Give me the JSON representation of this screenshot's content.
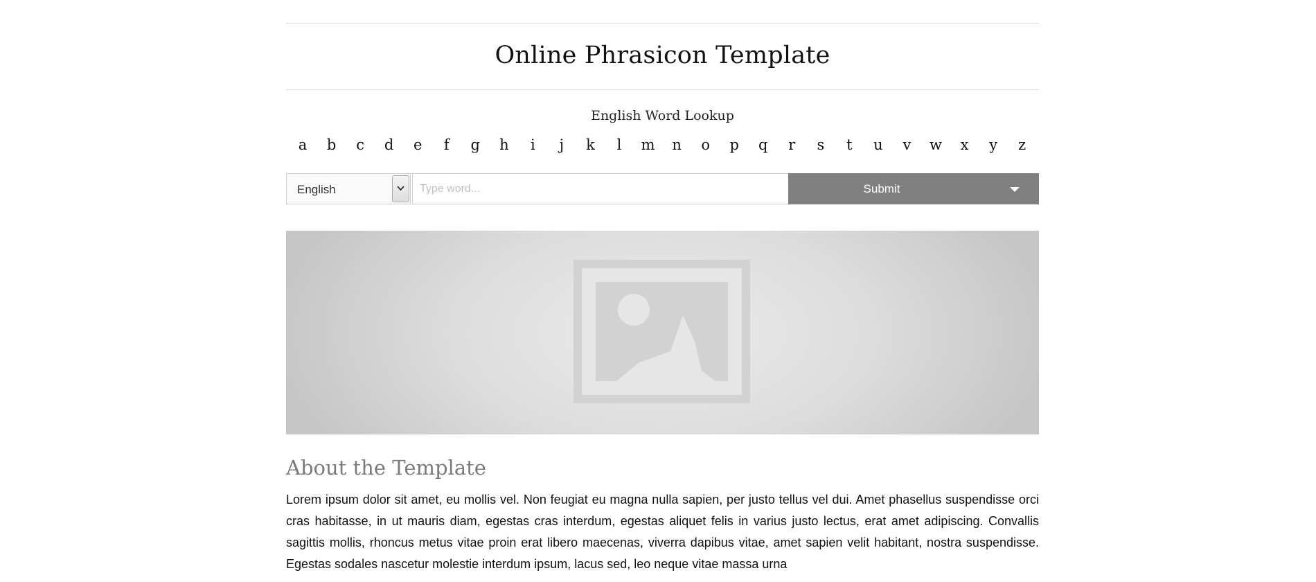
{
  "header": {
    "title": "Online Phrasicon Template"
  },
  "lookup": {
    "title": "English Word Lookup",
    "letters": [
      "a",
      "b",
      "c",
      "d",
      "e",
      "f",
      "g",
      "h",
      "i",
      "j",
      "k",
      "l",
      "m",
      "n",
      "o",
      "p",
      "q",
      "r",
      "s",
      "t",
      "u",
      "v",
      "w",
      "x",
      "y",
      "z"
    ]
  },
  "search": {
    "language_value": "English",
    "input_value": "",
    "input_placeholder": "Type word...",
    "submit_label": "Submit"
  },
  "banner": {
    "icon": "image-placeholder-icon"
  },
  "about": {
    "heading": "About the Template",
    "body": "Lorem ipsum dolor sit amet, eu mollis vel. Non feugiat eu magna nulla sapien, per justo tellus vel dui. Amet phasellus suspendisse orci cras habitasse, in ut mauris diam, egestas cras interdum, egestas aliquet felis in varius justo lectus, erat amet adipiscing. Convallis sagittis mollis, rhoncus metus vitae proin erat libero maecenas, viverra dapibus vitae, amet sapien velit habitant, nostra suspendisse. Egestas sodales nascetur molestie interdum ipsum, lacus sed, leo neque vitae massa urna"
  },
  "colors": {
    "submit_background": "#808080",
    "heading_gray": "#7a7a7a",
    "rule": "#dcdcdc"
  }
}
